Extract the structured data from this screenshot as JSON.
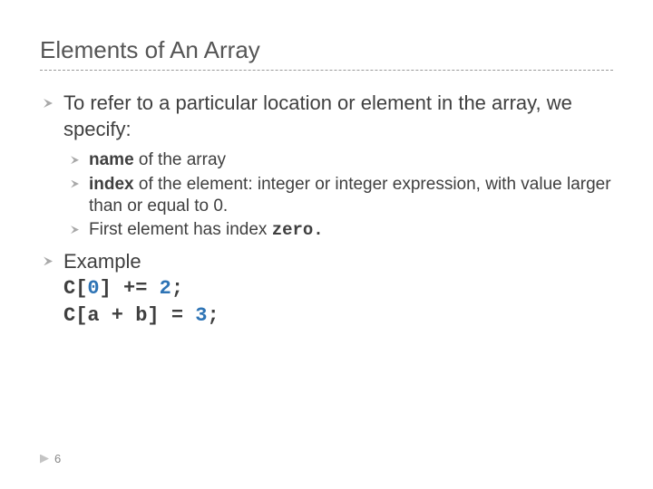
{
  "title": "Elements of An Array",
  "bullets": {
    "intro": "To refer to a particular location or element in the array, we specify:",
    "sub1_bold": "name",
    "sub1_rest": " of the array",
    "sub2_bold": "index",
    "sub2_rest": " of the element:  integer or integer expression, with value larger than or equal to 0.",
    "sub3_pre": "First element has index ",
    "sub3_code": "zero.",
    "example_label": "Example",
    "code_line1_a": "C[",
    "code_line1_b": "0",
    "code_line1_c": "] += ",
    "code_line1_d": "2",
    "code_line1_e": ";",
    "code_line2_a": "C[a + b] = ",
    "code_line2_b": "3",
    "code_line2_c": ";"
  },
  "page_number": "6"
}
